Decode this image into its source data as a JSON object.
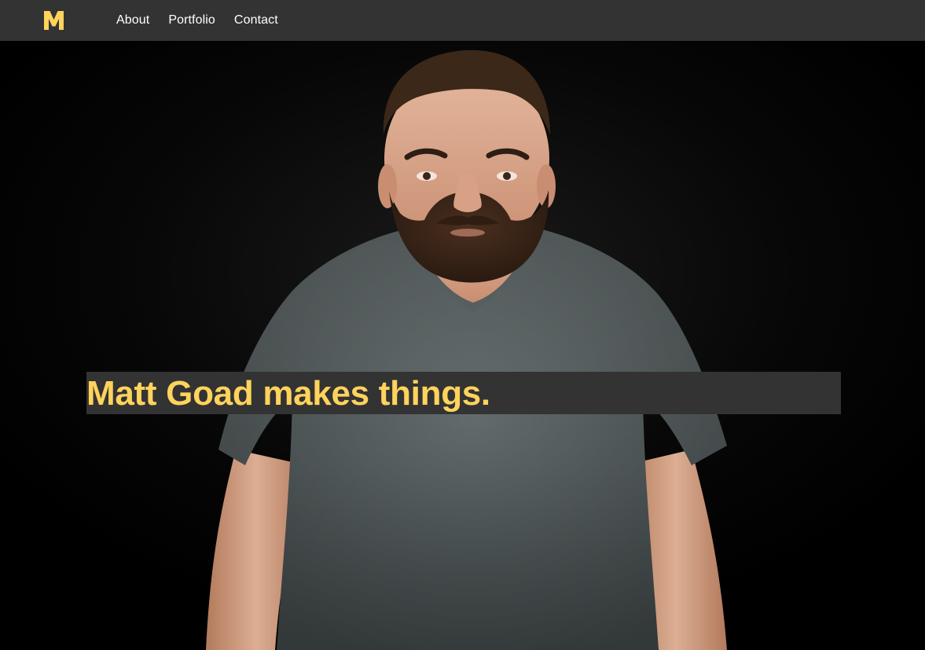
{
  "nav": {
    "logo_letter": "M",
    "links": [
      {
        "label": "About"
      },
      {
        "label": "Portfolio"
      },
      {
        "label": "Contact"
      }
    ]
  },
  "hero": {
    "headline": "Matt Goad makes things.",
    "photo_icon": "portrait-photo"
  },
  "colors": {
    "nav_bg": "#333333",
    "accent": "#ffd35c",
    "headline_bg": "#333333",
    "page_bg": "#000000"
  }
}
